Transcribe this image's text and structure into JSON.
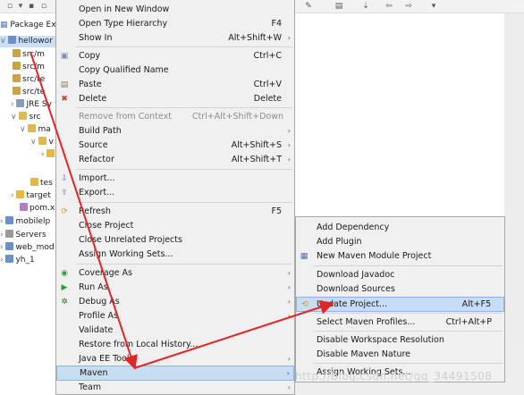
{
  "explorer": {
    "title": "Package Exp",
    "rows": [
      {
        "label": "hellowor"
      },
      {
        "label": "src/m"
      },
      {
        "label": "src/m"
      },
      {
        "label": "src/te"
      },
      {
        "label": "src/te"
      },
      {
        "label": "JRE Sy"
      },
      {
        "label": "src"
      },
      {
        "label": "ma"
      },
      {
        "label": "v"
      },
      {
        "label": ""
      },
      {
        "label": "tes"
      },
      {
        "label": "target"
      },
      {
        "label": "pom.x"
      },
      {
        "label": "mobilelp"
      },
      {
        "label": "Servers"
      },
      {
        "label": "web_mod"
      },
      {
        "label": "yh_1"
      }
    ]
  },
  "context_menu": {
    "items": [
      {
        "label": "Open in New Window",
        "accel": ""
      },
      {
        "label": "Open Type Hierarchy",
        "accel": "F4"
      },
      {
        "label": "Show In",
        "accel": "Alt+Shift+W"
      },
      {
        "label": "Copy",
        "accel": "Ctrl+C"
      },
      {
        "label": "Copy Qualified Name",
        "accel": ""
      },
      {
        "label": "Paste",
        "accel": "Ctrl+V"
      },
      {
        "label": "Delete",
        "accel": "Delete"
      },
      {
        "label": "Remove from Context",
        "accel": "Ctrl+Alt+Shift+Down"
      },
      {
        "label": "Build Path",
        "accel": ""
      },
      {
        "label": "Source",
        "accel": "Alt+Shift+S"
      },
      {
        "label": "Refactor",
        "accel": "Alt+Shift+T"
      },
      {
        "label": "Import...",
        "accel": ""
      },
      {
        "label": "Export...",
        "accel": ""
      },
      {
        "label": "Refresh",
        "accel": "F5"
      },
      {
        "label": "Close Project",
        "accel": ""
      },
      {
        "label": "Close Unrelated Projects",
        "accel": ""
      },
      {
        "label": "Assign Working Sets...",
        "accel": ""
      },
      {
        "label": "Coverage As",
        "accel": ""
      },
      {
        "label": "Run As",
        "accel": ""
      },
      {
        "label": "Debug As",
        "accel": ""
      },
      {
        "label": "Profile As",
        "accel": ""
      },
      {
        "label": "Validate",
        "accel": ""
      },
      {
        "label": "Restore from Local History...",
        "accel": ""
      },
      {
        "label": "Java EE Tools",
        "accel": ""
      },
      {
        "label": "Maven",
        "accel": ""
      },
      {
        "label": "Team",
        "accel": ""
      }
    ]
  },
  "maven_submenu": {
    "items": [
      {
        "label": "Add Dependency",
        "accel": ""
      },
      {
        "label": "Add Plugin",
        "accel": ""
      },
      {
        "label": "New Maven Module Project",
        "accel": ""
      },
      {
        "label": "Download Javadoc",
        "accel": ""
      },
      {
        "label": "Download Sources",
        "accel": ""
      },
      {
        "label": "Update Project...",
        "accel": "Alt+F5"
      },
      {
        "label": "Select Maven Profiles...",
        "accel": "Ctrl+Alt+P"
      },
      {
        "label": "Disable Workspace Resolution",
        "accel": ""
      },
      {
        "label": "Disable Maven Nature",
        "accel": ""
      },
      {
        "label": "Assign Working Sets...",
        "accel": ""
      }
    ]
  },
  "watermark": "http://blog.csdn.net/qq_34491508",
  "icons": {
    "copy": "copy-icon",
    "paste": "paste-icon",
    "delete": "delete-x-icon",
    "import": "import-icon",
    "export": "export-icon",
    "refresh": "refresh-icon",
    "coverage": "coverage-icon",
    "run": "run-icon",
    "debug": "debug-icon",
    "maven": "maven-icon",
    "update": "update-icon"
  },
  "colors": {
    "menu_bg": "#f0f0f0",
    "highlight": "#c7ddf3",
    "highlight_border": "#8db2e3",
    "arrow": "#e32525",
    "disabled_text": "#8c8c8c"
  }
}
